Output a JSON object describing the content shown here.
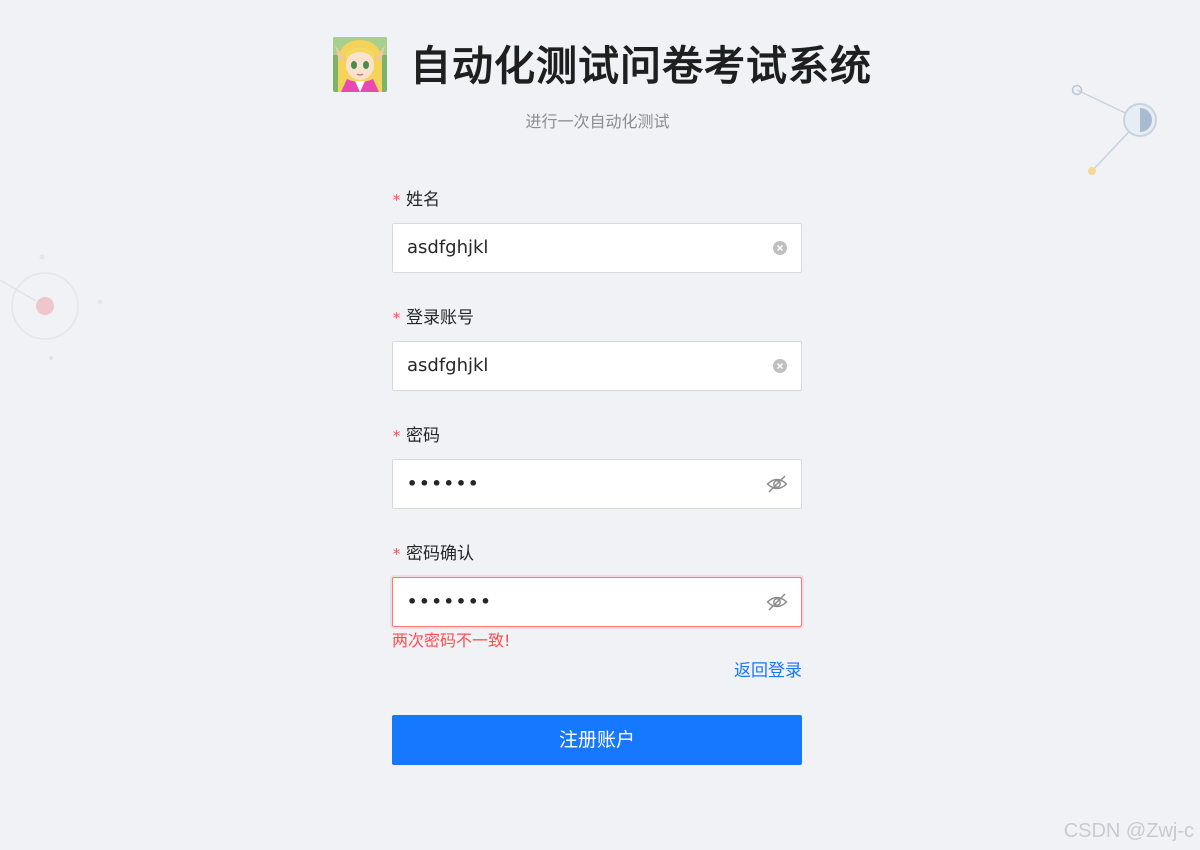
{
  "header": {
    "app_title": "自动化测试问卷考试系统",
    "subtitle": "进行一次自动化测试"
  },
  "form": {
    "fields": [
      {
        "label": "姓名",
        "value": "asdfghjkl",
        "type": "text"
      },
      {
        "label": "登录账号",
        "value": "asdfghjkl",
        "type": "text"
      },
      {
        "label": "密码",
        "value": "••••••",
        "type": "password"
      },
      {
        "label": "密码确认",
        "value": "•••••••",
        "type": "password"
      }
    ],
    "required_mark": "*",
    "error_message": "两次密码不一致!",
    "back_link": "返回登录",
    "submit_label": "注册账户"
  },
  "watermark": "CSDN @Zwj-c",
  "colors": {
    "primary": "#1677ff",
    "error": "#ff4d4f",
    "background": "#f0f2f5"
  }
}
